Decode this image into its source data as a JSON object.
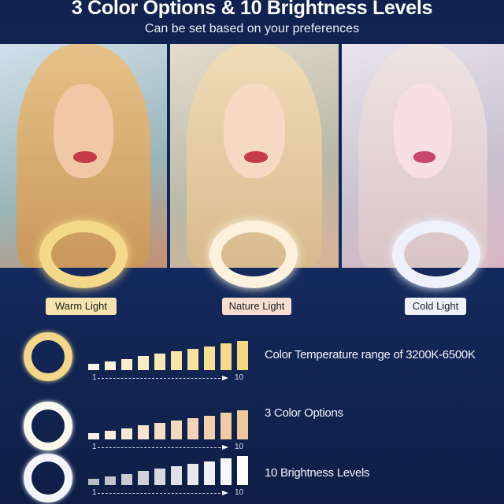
{
  "header": {
    "title": "3 Color Options & 10 Brightness Levels",
    "subtitle": "Can be set based on your preferences"
  },
  "modes": [
    {
      "label": "Warm Light",
      "ring_color": "#f5d98a",
      "label_bg": "#f6e3ad"
    },
    {
      "label": "Nature Light",
      "ring_color": "#fbf1dc",
      "label_bg": "#f7ddd2"
    },
    {
      "label": "Cold Light",
      "ring_color": "#eef1fb",
      "label_bg": "#eef0fa"
    }
  ],
  "rows": [
    {
      "text": "Color Temperature range of 3200K-6500K",
      "ring_color": "#f3d68a",
      "bar_from": "#fbf6e4",
      "bar_to": "#f3d77f"
    },
    {
      "text": "3 Color Options",
      "ring_color": "#fbf8ee",
      "bar_from": "#fbf1e6",
      "bar_to": "#efc79d"
    },
    {
      "text": "10 Brightness Levels",
      "ring_color": "#f2f3fb",
      "bar_from": "#b8bcc4",
      "bar_to": "#ffffff"
    }
  ],
  "scale": {
    "start": "1",
    "end": "10",
    "levels": 10
  }
}
